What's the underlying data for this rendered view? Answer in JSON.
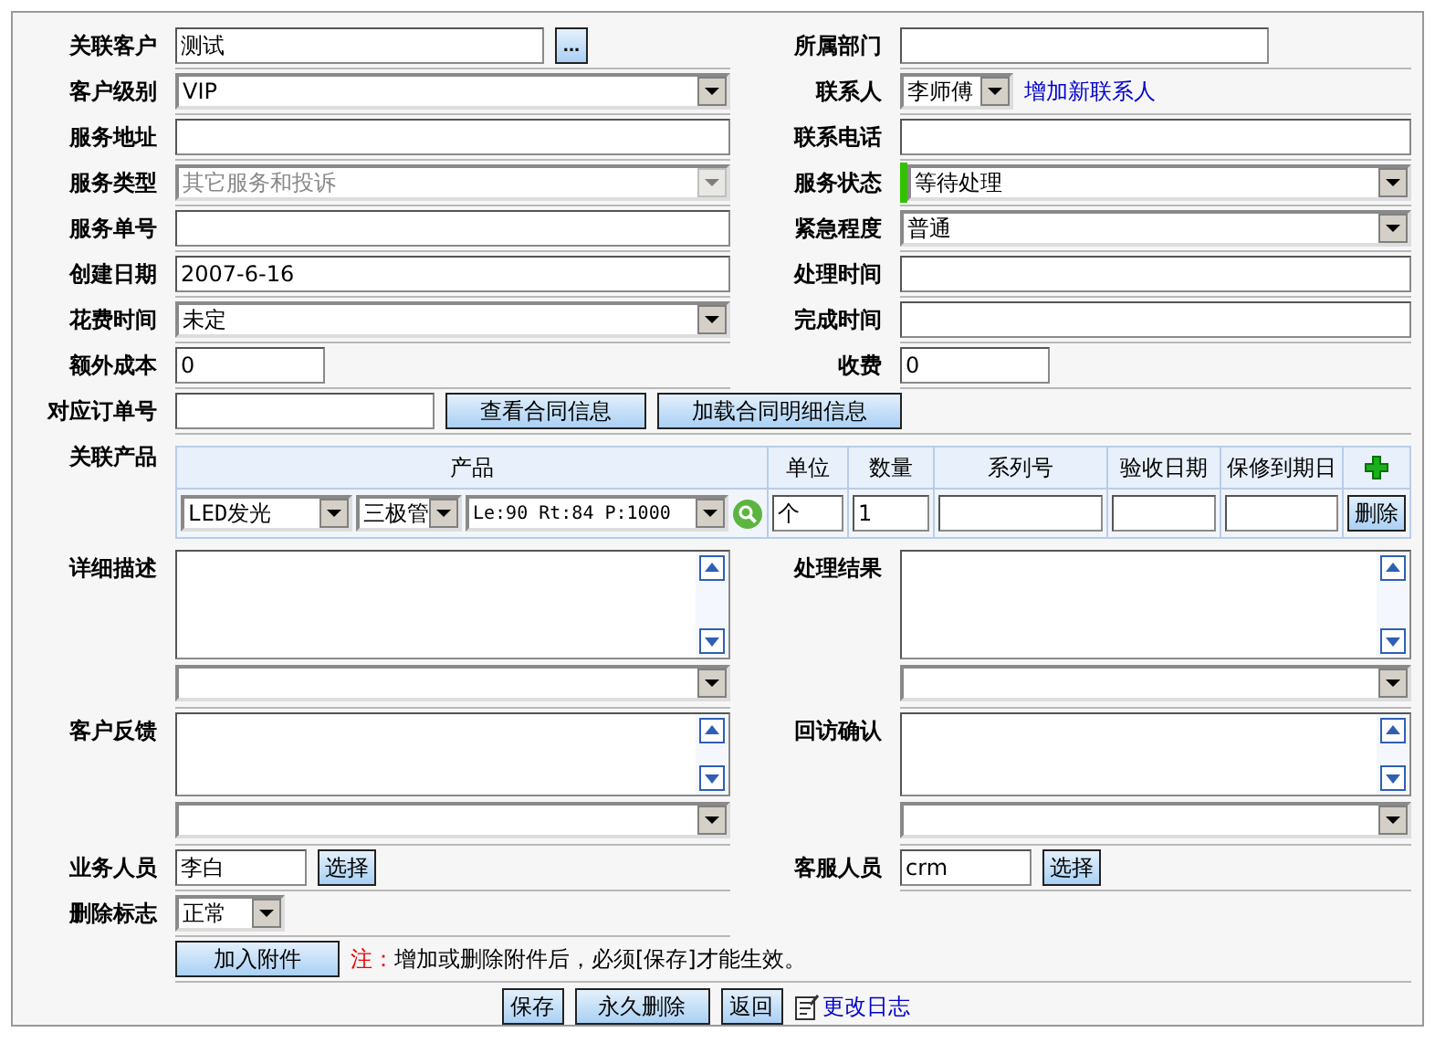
{
  "form": {
    "rows": [
      {
        "left": {
          "label": "关联客户",
          "field": {
            "kind": "input_medium",
            "value": "测试",
            "button": "..."
          }
        },
        "right": {
          "label": "所属部门",
          "field": {
            "kind": "input_medium"
          }
        }
      },
      {
        "left": {
          "label": "客户级别",
          "field": {
            "kind": "select",
            "value": "VIP",
            "disabled": false,
            "highlighted": false
          }
        },
        "right": {
          "label": "联系人",
          "field": {
            "kind": "select_small",
            "value": "李师傅",
            "disabled": false,
            "highlighted": false,
            "link": "增加新联系人"
          }
        }
      },
      {
        "left": {
          "label": "服务地址",
          "field": {
            "kind": "input"
          }
        },
        "right": {
          "label": "联系电话",
          "field": {
            "kind": "input"
          }
        }
      },
      {
        "left": {
          "label": "服务类型",
          "field": {
            "kind": "select",
            "value": "其它服务和投诉",
            "disabled": true,
            "highlighted": false
          }
        },
        "right": {
          "label": "服务状态",
          "field": {
            "kind": "select",
            "value": "等待处理",
            "disabled": false,
            "highlighted": true
          }
        }
      },
      {
        "left": {
          "label": "服务单号",
          "field": {
            "kind": "input"
          }
        },
        "right": {
          "label": "紧急程度",
          "field": {
            "kind": "select",
            "value": "普通",
            "disabled": false,
            "highlighted": false
          }
        }
      },
      {
        "left": {
          "label": "创建日期",
          "field": {
            "kind": "input",
            "value": "2007-6-16"
          }
        },
        "right": {
          "label": "处理时间",
          "field": {
            "kind": "input"
          }
        }
      },
      {
        "left": {
          "label": "花费时间",
          "field": {
            "kind": "select",
            "value": "未定",
            "disabled": false,
            "highlighted": false
          }
        },
        "right": {
          "label": "完成时间",
          "field": {
            "kind": "input"
          }
        }
      },
      {
        "left": {
          "label": "额外成本",
          "field": {
            "kind": "input_short",
            "value": "0"
          }
        },
        "right": {
          "label": "收费",
          "field": {
            "kind": "input_short",
            "value": "0"
          }
        }
      }
    ],
    "order": {
      "label": "对应订单号",
      "buttons": [
        "查看合同信息",
        "加载合同明细信息"
      ]
    },
    "products": {
      "label": "关联产品",
      "columns": [
        "产品",
        "单位",
        "数量",
        "系列号",
        "验收日期",
        "保修到期日"
      ],
      "rows": [
        {
          "product": [
            "LED发光",
            "三极管",
            "Le:90 Rt:84 P:1000"
          ],
          "unit": "个",
          "quantity": "1",
          "delete_button": "删除"
        }
      ]
    },
    "memos": [
      {
        "left": "详细描述",
        "right": "处理结果"
      },
      {
        "left": "客户反馈",
        "right": "回访确认"
      }
    ],
    "staff": {
      "left": {
        "label": "业务人员",
        "value": "李白",
        "button": "选择"
      },
      "right": {
        "label": "客服人员",
        "value": "crm",
        "button": "选择"
      }
    },
    "delete_flag": {
      "label": "删除标志",
      "value": "正常"
    },
    "attachment": {
      "button": "加入附件",
      "note_prefix": "注：",
      "note": "增加或删除附件后，必须[保存]才能生效。"
    },
    "footer": {
      "buttons": [
        "保存",
        "永久删除",
        "返回"
      ],
      "link": "更改日志"
    }
  }
}
